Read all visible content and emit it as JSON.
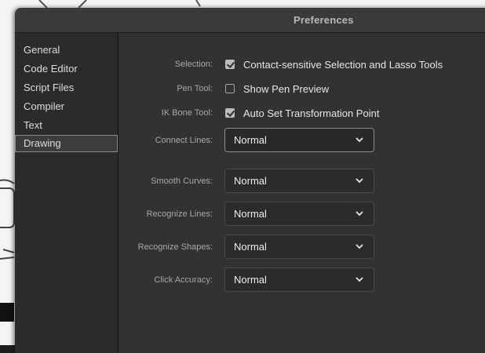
{
  "window": {
    "title": "Preferences"
  },
  "sidebar": {
    "items": [
      {
        "label": "General",
        "selected": false
      },
      {
        "label": "Code Editor",
        "selected": false
      },
      {
        "label": "Script Files",
        "selected": false
      },
      {
        "label": "Compiler",
        "selected": false
      },
      {
        "label": "Text",
        "selected": false
      },
      {
        "label": "Drawing",
        "selected": true
      }
    ]
  },
  "drawing": {
    "selection": {
      "label": "Selection:",
      "option": "Contact-sensitive Selection and Lasso Tools",
      "checked": true
    },
    "pen_tool": {
      "label": "Pen Tool:",
      "option": "Show Pen Preview",
      "checked": false
    },
    "ik_bone_tool": {
      "label": "IK Bone Tool:",
      "option": "Auto Set Transformation Point",
      "checked": true
    },
    "connect_lines": {
      "label": "Connect Lines:",
      "value": "Normal"
    },
    "smooth_curves": {
      "label": "Smooth Curves:",
      "value": "Normal"
    },
    "recognize_lines": {
      "label": "Recognize Lines:",
      "value": "Normal"
    },
    "recognize_shapes": {
      "label": "Recognize Shapes:",
      "value": "Normal"
    },
    "click_accuracy": {
      "label": "Click Accuracy:",
      "value": "Normal"
    }
  },
  "icons": {
    "checkbox_checked": "checkmark-icon",
    "dropdown": "chevron-down-icon"
  },
  "colors": {
    "dialog_bg": "#2d2d2d",
    "content_bg": "#323232",
    "sidebar_bg": "#2b2b2b",
    "titlebar_bg": "#3a3a3a",
    "text": "#e6e6e6",
    "label": "#a8a8a8"
  }
}
